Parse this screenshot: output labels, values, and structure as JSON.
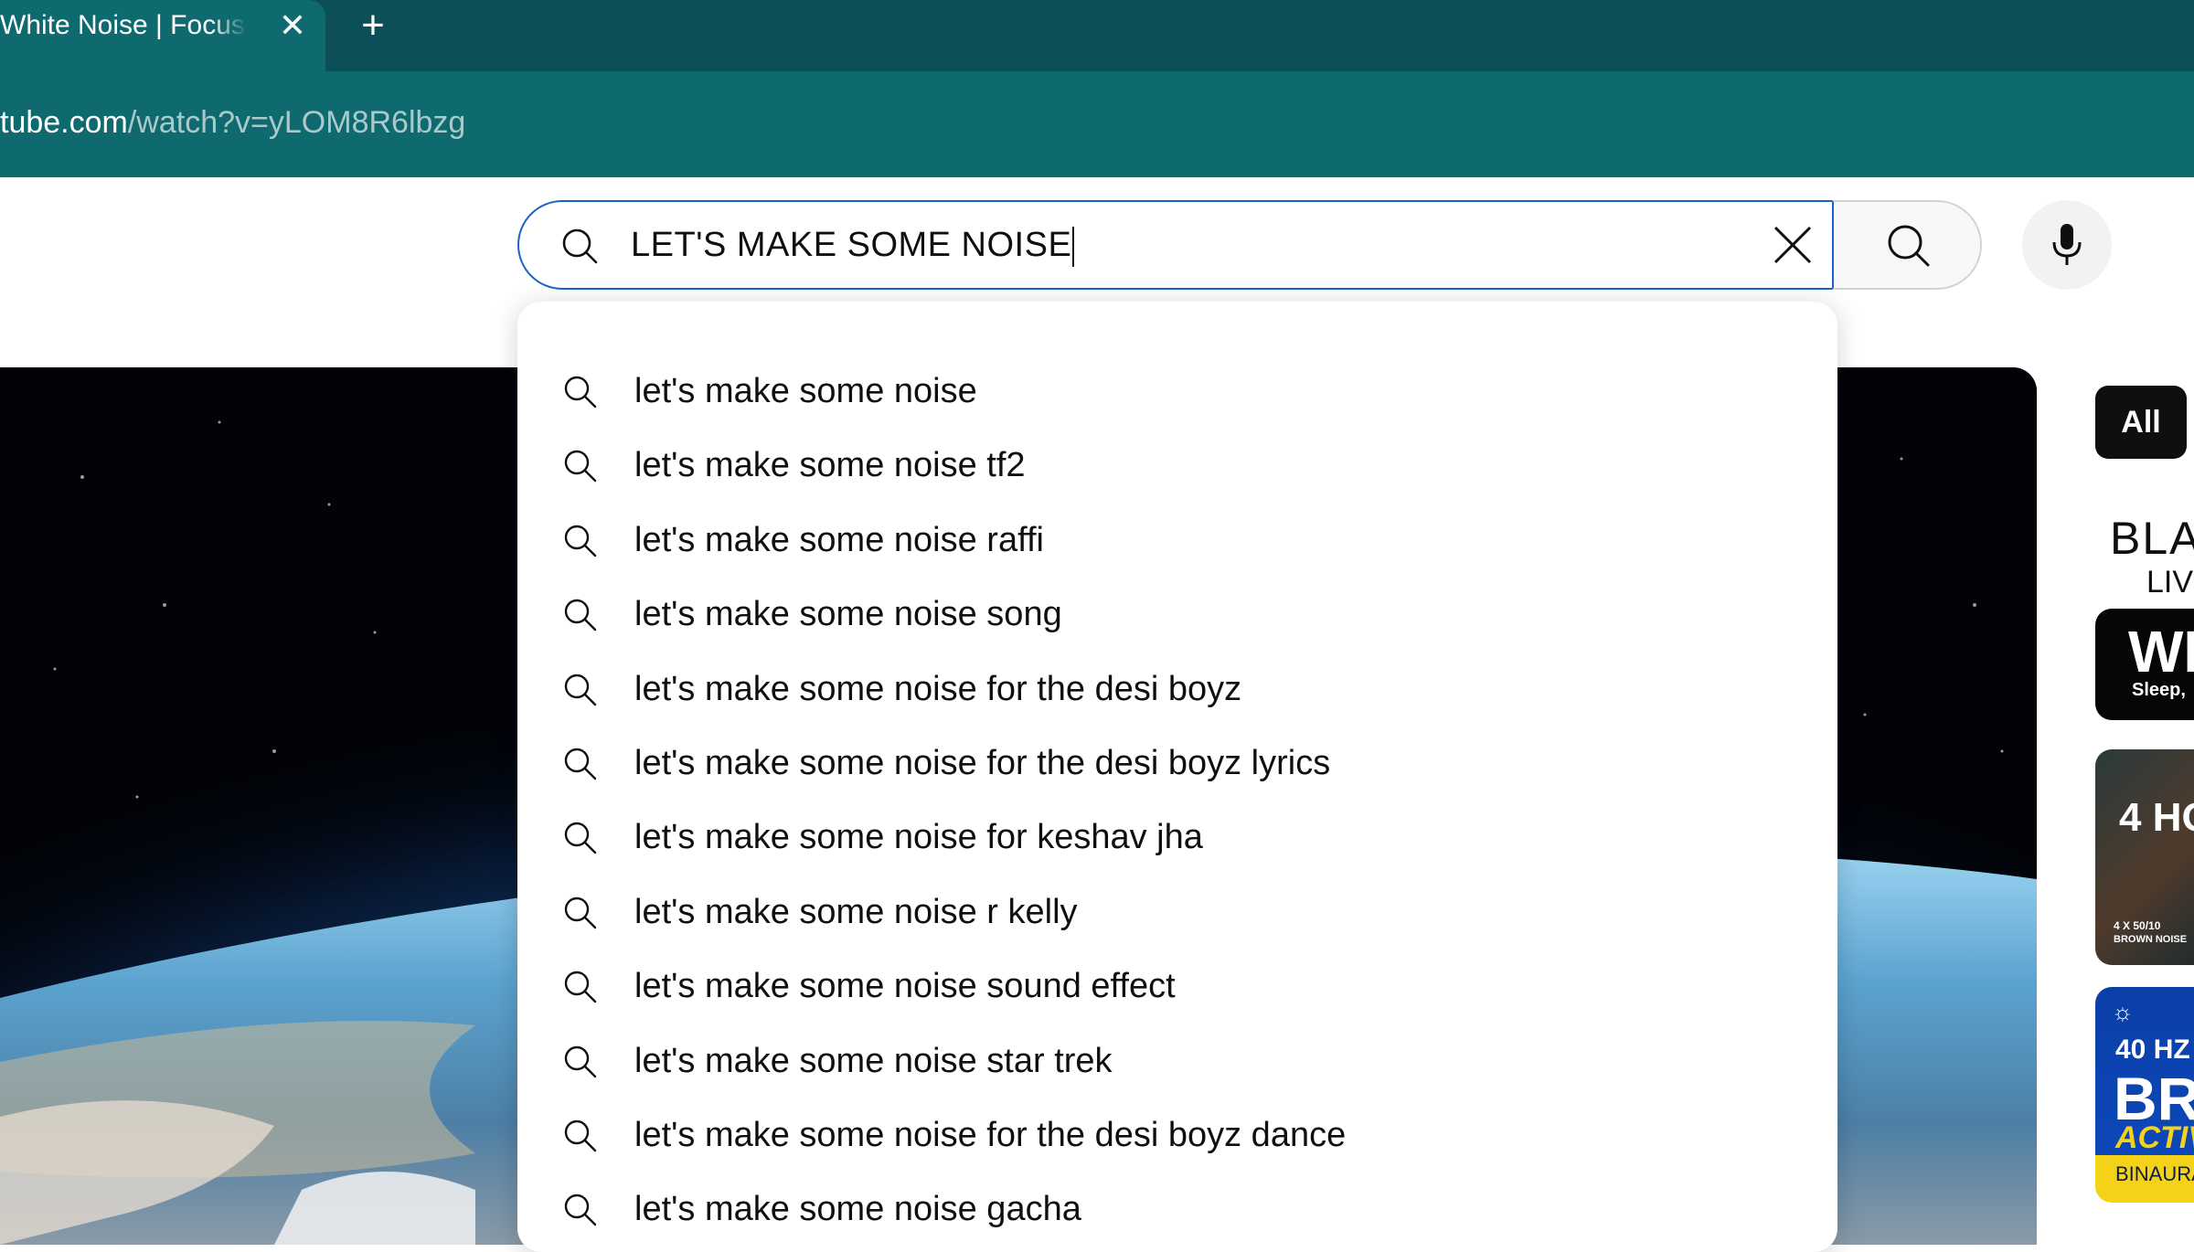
{
  "browser": {
    "tab_title": "White Noise | Focus",
    "close_tab_glyph": "✕",
    "new_tab_glyph": "+",
    "url_host": "tube.com",
    "url_path": "/watch?v=yLOM8R6lbzg"
  },
  "search": {
    "query": "LET'S MAKE SOME NOISE",
    "icons": {
      "inner": "search-icon",
      "clear": "close-icon",
      "submit": "search-icon",
      "voice": "microphone-icon"
    },
    "accent_color": "#1a62c6"
  },
  "suggestions": [
    "let's make some noise",
    "let's make some noise tf2",
    "let's make some noise raffi",
    "let's make some noise song",
    "let's make some noise for the desi boyz",
    "let's make some noise for the desi boyz lyrics",
    "let's make some noise for keshav jha",
    "let's make some noise r kelly",
    "let's make some noise sound effect",
    "let's make some noise star trek",
    "let's make some noise for the desi boyz dance",
    "let's make some noise gacha"
  ],
  "sidebar": {
    "chip_all": "All",
    "thumb1_line1": "BLA",
    "thumb1_line2": "LIV",
    "thumb1_line3": "WI",
    "thumb1_line4": "Sleep,",
    "thumb2_line1": "4 HO",
    "thumb2_line2": "4 X 50/10",
    "thumb2_line3": "BROWN NOISE",
    "thumb3_line1": "40 HZ",
    "thumb3_line2": "BR",
    "thumb3_line3": "ACTIV",
    "thumb3_line4": "BINAURA"
  }
}
